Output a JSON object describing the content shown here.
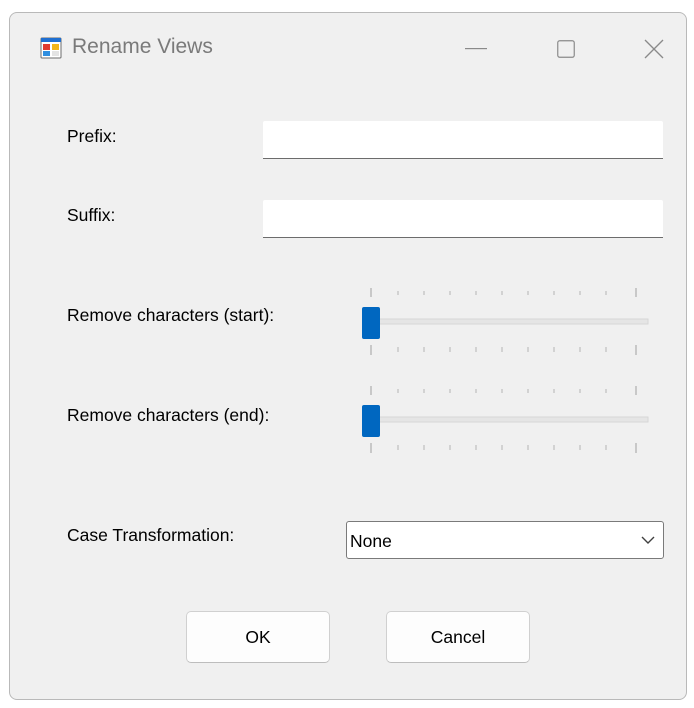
{
  "window": {
    "title": "Rename Views",
    "icon": "application-form-icon",
    "controls": {
      "minimize": "minimize-icon",
      "maximize": "maximize-icon",
      "close": "close-icon"
    }
  },
  "form": {
    "prefix_label": "Prefix:",
    "prefix_value": "",
    "suffix_label": "Suffix:",
    "suffix_value": "",
    "remove_start_label": "Remove characters (start):",
    "remove_start_value": 0,
    "remove_end_label": "Remove characters (end):",
    "remove_end_value": 0,
    "case_label": "Case Transformation:",
    "case_selected": "None"
  },
  "buttons": {
    "ok_label": "OK",
    "cancel_label": "Cancel"
  },
  "colors": {
    "accent": "#0067c0",
    "window_bg": "#f0f0f0",
    "track": "#e5e5e5",
    "tick": "#a0a0a0"
  }
}
